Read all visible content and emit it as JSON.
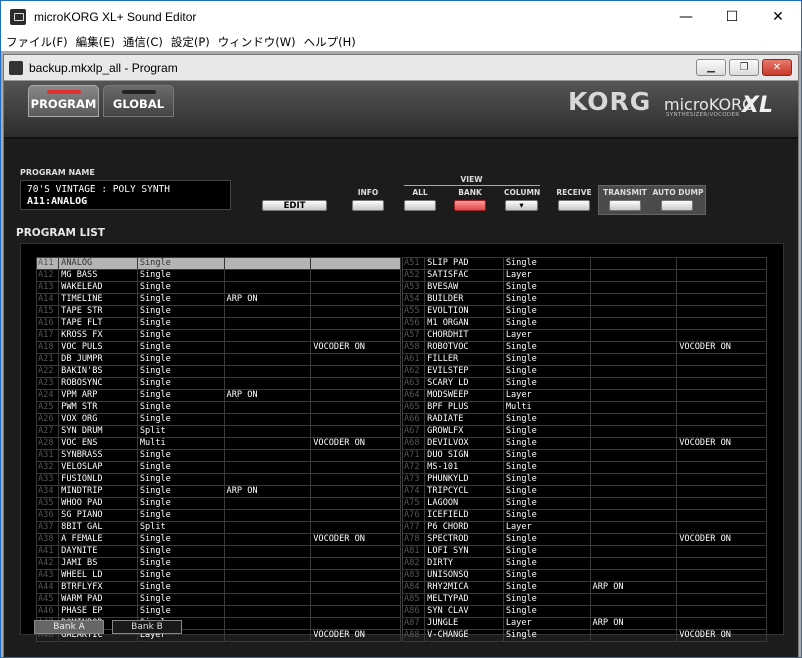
{
  "window": {
    "title": "microKORG XL+ Sound Editor",
    "min": "—",
    "max": "☐",
    "close": "✕"
  },
  "menu": [
    "ファイル(F)",
    "編集(E)",
    "通信(C)",
    "設定(P)",
    "ウィンドウ(W)",
    "ヘルプ(H)"
  ],
  "child": {
    "title": "backup.mkxlp_all - Program"
  },
  "tabs": {
    "program": "PROGRAM",
    "global": "GLOBAL",
    "active_led_color": "#e03030",
    "inactive_led_color": "#222"
  },
  "brand": {
    "korg": "KORG",
    "model": "microKORG",
    "xl": "XL",
    "tagline": "SYNTHESIZER/VOCODER"
  },
  "program_name": {
    "label": "PROGRAM NAME",
    "line1": "70'S VINTAGE : POLY SYNTH",
    "line2": "A11:ANALOG"
  },
  "buttons": {
    "edit": "EDIT",
    "info": "INFO",
    "view": "VIEW",
    "all": "ALL",
    "bank": "BANK",
    "column": "COLUMN",
    "receive": "RECEIVE",
    "transmit": "TRANSMIT",
    "auto_dump": "AUTO DUMP"
  },
  "program_list": {
    "label": "PROGRAM LIST",
    "left": [
      [
        "A11",
        "ANALOG",
        "Single",
        "",
        ""
      ],
      [
        "A12",
        "MG BASS",
        "Single",
        "",
        ""
      ],
      [
        "A13",
        "WAKELEAD",
        "Single",
        "",
        ""
      ],
      [
        "A14",
        "TIMELINE",
        "Single",
        "ARP ON",
        ""
      ],
      [
        "A15",
        "TAPE STR",
        "Single",
        "",
        ""
      ],
      [
        "A16",
        "TAPE FLT",
        "Single",
        "",
        ""
      ],
      [
        "A17",
        "KROSS FX",
        "Single",
        "",
        ""
      ],
      [
        "A18",
        "VOC PULS",
        "Single",
        "",
        "VOCODER ON"
      ],
      [
        "A21",
        "DB JUMPR",
        "Single",
        "",
        ""
      ],
      [
        "A22",
        "BAKIN'BS",
        "Single",
        "",
        ""
      ],
      [
        "A23",
        "ROBOSYNC",
        "Single",
        "",
        ""
      ],
      [
        "A24",
        "VPM ARP",
        "Single",
        "ARP ON",
        ""
      ],
      [
        "A25",
        "PWM STR",
        "Single",
        "",
        ""
      ],
      [
        "A26",
        "VOX ORG",
        "Single",
        "",
        ""
      ],
      [
        "A27",
        "SYN DRUM",
        "Split",
        "",
        ""
      ],
      [
        "A28",
        "VOC ENS",
        "Multi",
        "",
        "VOCODER ON"
      ],
      [
        "A31",
        "SYNBRASS",
        "Single",
        "",
        ""
      ],
      [
        "A32",
        "VELOSLAP",
        "Single",
        "",
        ""
      ],
      [
        "A33",
        "FUSIONLD",
        "Single",
        "",
        ""
      ],
      [
        "A34",
        "MINDTRIP",
        "Single",
        "ARP ON",
        ""
      ],
      [
        "A35",
        "WHOO PAD",
        "Single",
        "",
        ""
      ],
      [
        "A36",
        "SG PIANO",
        "Single",
        "",
        ""
      ],
      [
        "A37",
        "8BIT GAL",
        "Split",
        "",
        ""
      ],
      [
        "A38",
        "A FEMALE",
        "Single",
        "",
        "VOCODER ON"
      ],
      [
        "A41",
        "DAYNITE",
        "Single",
        "",
        ""
      ],
      [
        "A42",
        "JAMI BS",
        "Single",
        "",
        ""
      ],
      [
        "A43",
        "WHEEL LD",
        "Single",
        "",
        ""
      ],
      [
        "A44",
        "BTRFLYFX",
        "Single",
        "",
        ""
      ],
      [
        "A45",
        "WARM PAD",
        "Single",
        "",
        ""
      ],
      [
        "A46",
        "PHASE EP",
        "Single",
        "",
        ""
      ],
      [
        "A47",
        "DOMINBOR",
        "Single",
        "",
        ""
      ],
      [
        "A48",
        "GALAKTIC",
        "Layer",
        "",
        "VOCODER ON"
      ]
    ],
    "right": [
      [
        "A51",
        "SLIP PAD",
        "Single",
        "",
        ""
      ],
      [
        "A52",
        "SATISFAC",
        "Layer",
        "",
        ""
      ],
      [
        "A53",
        "BVESAW",
        "Single",
        "",
        ""
      ],
      [
        "A54",
        "BUILDER",
        "Single",
        "",
        ""
      ],
      [
        "A55",
        "EVOLTION",
        "Single",
        "",
        ""
      ],
      [
        "A56",
        "M1 ORGAN",
        "Single",
        "",
        ""
      ],
      [
        "A57",
        "CHORDHIT",
        "Layer",
        "",
        ""
      ],
      [
        "A58",
        "ROBOTVOC",
        "Single",
        "",
        "VOCODER ON"
      ],
      [
        "A61",
        "FILLER",
        "Single",
        "",
        ""
      ],
      [
        "A62",
        "EVILSTEP",
        "Single",
        "",
        ""
      ],
      [
        "A63",
        "SCARY LD",
        "Single",
        "",
        ""
      ],
      [
        "A64",
        "MODSWEEP",
        "Layer",
        "",
        ""
      ],
      [
        "A65",
        "BPF PLUS",
        "Multi",
        "",
        ""
      ],
      [
        "A66",
        "RADIATE",
        "Single",
        "",
        ""
      ],
      [
        "A67",
        "GROWLFX",
        "Single",
        "",
        ""
      ],
      [
        "A68",
        "DEVILVOX",
        "Single",
        "",
        "VOCODER ON"
      ],
      [
        "A71",
        "DUO SIGN",
        "Single",
        "",
        ""
      ],
      [
        "A72",
        "MS-101",
        "Single",
        "",
        ""
      ],
      [
        "A73",
        "PHUNKYLD",
        "Single",
        "",
        ""
      ],
      [
        "A74",
        "TRIPCYCL",
        "Single",
        "",
        ""
      ],
      [
        "A75",
        "LAGOON",
        "Single",
        "",
        ""
      ],
      [
        "A76",
        "ICEFIELD",
        "Single",
        "",
        ""
      ],
      [
        "A77",
        "P6 CHORD",
        "Layer",
        "",
        ""
      ],
      [
        "A78",
        "SPECTROD",
        "Single",
        "",
        "VOCODER ON"
      ],
      [
        "A81",
        "LOFI SYN",
        "Single",
        "",
        ""
      ],
      [
        "A82",
        "DIRTY",
        "Single",
        "",
        ""
      ],
      [
        "A83",
        "UNISONSQ",
        "Single",
        "",
        ""
      ],
      [
        "A84",
        "RHY2MICA",
        "Single",
        "ARP ON",
        ""
      ],
      [
        "A85",
        "MELTYPAD",
        "Single",
        "",
        ""
      ],
      [
        "A86",
        "SYN CLAV",
        "Single",
        "",
        ""
      ],
      [
        "A87",
        "JUNGLE",
        "Layer",
        "ARP ON",
        ""
      ],
      [
        "A88",
        "V-CHANGE",
        "Single",
        "",
        "VOCODER ON"
      ]
    ]
  },
  "bank_tabs": [
    "Bank A",
    "Bank B"
  ]
}
